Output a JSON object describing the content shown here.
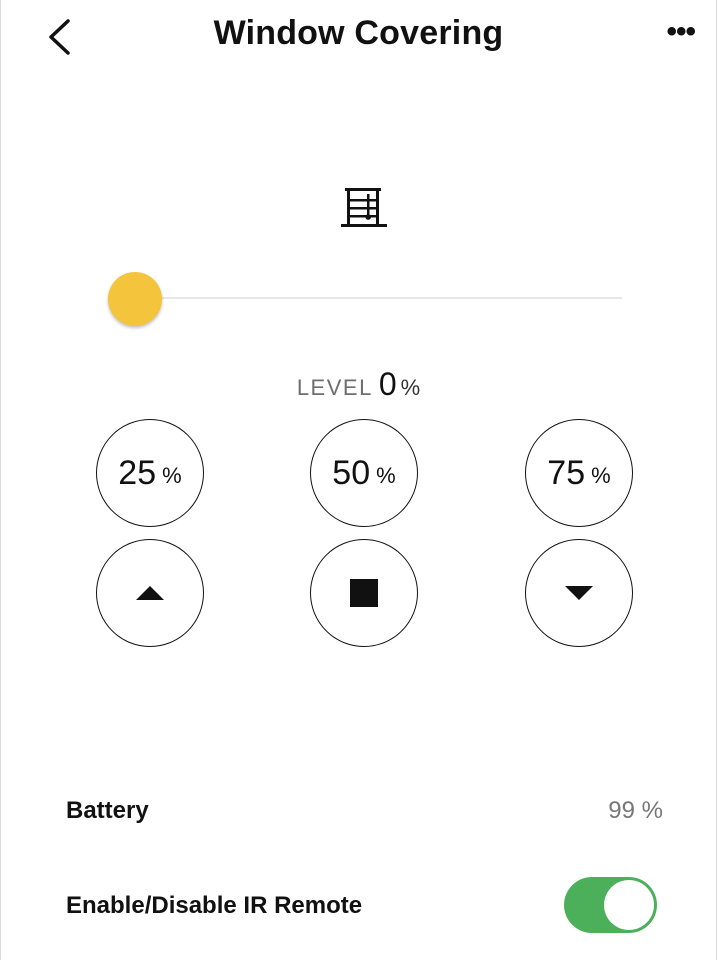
{
  "header": {
    "title": "Window Covering",
    "more_label": "•••"
  },
  "icons": {
    "back": "chevron-left-icon",
    "device": "window-covering-icon",
    "up": "triangle-up-icon",
    "stop": "square-stop-icon",
    "down": "triangle-down-icon"
  },
  "slider": {
    "level_fraction": 0.0,
    "thumb_color": "#f5c43d"
  },
  "level": {
    "label": "LEVEL",
    "value": "0",
    "unit": "%"
  },
  "presets": [
    {
      "value": "25",
      "unit": "%"
    },
    {
      "value": "50",
      "unit": "%"
    },
    {
      "value": "75",
      "unit": "%"
    }
  ],
  "battery": {
    "label": "Battery",
    "value": "99 %"
  },
  "ir_remote": {
    "label": "Enable/Disable IR Remote",
    "enabled": true,
    "toggle_color": "#4caf59"
  }
}
